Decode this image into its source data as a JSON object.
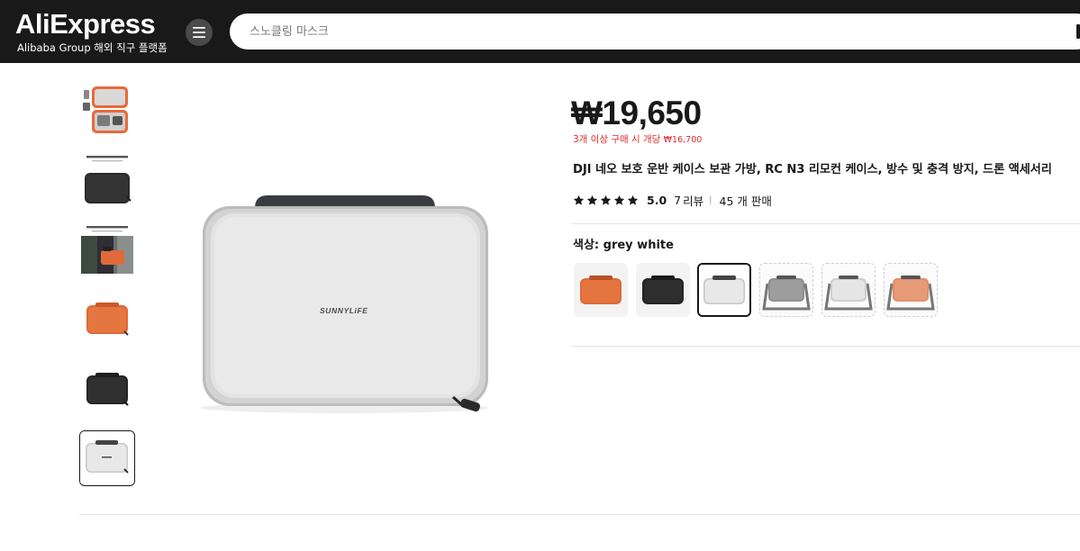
{
  "header": {
    "logo_text": "AliExpress",
    "logo_sub": "Alibaba Group 해외 직구 플랫폼",
    "search_placeholder": "스노클링 마스크"
  },
  "gallery": {
    "thumbnails": [
      {
        "name": "case-open-with-drone",
        "color": "#e86a3c"
      },
      {
        "name": "black-case",
        "caption": "High-quality Matte Leather",
        "color": "#2b2b2b"
      },
      {
        "name": "lifestyle-carry",
        "caption": "Portable & Easy Storage",
        "color": "#e06a3a"
      },
      {
        "name": "orange-case",
        "color": "#e06a3a"
      },
      {
        "name": "black-case",
        "color": "#2b2b2b"
      },
      {
        "name": "grey-white-case",
        "color": "#e4e4e4",
        "selected": true
      }
    ],
    "main_image": {
      "brand_text": "SUNNYLiFE",
      "color": "grey white"
    }
  },
  "product": {
    "price": "₩19,650",
    "promo_prefix": "3개 이상 구매 시 개당",
    "promo_price": "₩16,700",
    "title": "DJI 네오 보호 운반 케이스 보관 가방, RC N3 리모컨 케이스, 방수 및 충격 방지, 드론 액세서리",
    "rating": "5.0",
    "stars": 5,
    "review_count": "7",
    "review_label": "리뷰",
    "separator": "|",
    "sold": "45 개 판매",
    "color_label": "색상: grey white",
    "swatches": [
      {
        "name": "orange",
        "color": "#df6a3b",
        "style": "solid"
      },
      {
        "name": "black",
        "color": "#2a2a2a",
        "style": "solid"
      },
      {
        "name": "grey white",
        "color": "#e6e6e6",
        "style": "selected"
      },
      {
        "name": "grey with strap",
        "color": "#9a9a9a",
        "style": "dashed"
      },
      {
        "name": "grey white with strap",
        "color": "#e2e2e2",
        "style": "dashed"
      },
      {
        "name": "orange with strap",
        "color": "#e79a78",
        "style": "dashed"
      }
    ]
  }
}
